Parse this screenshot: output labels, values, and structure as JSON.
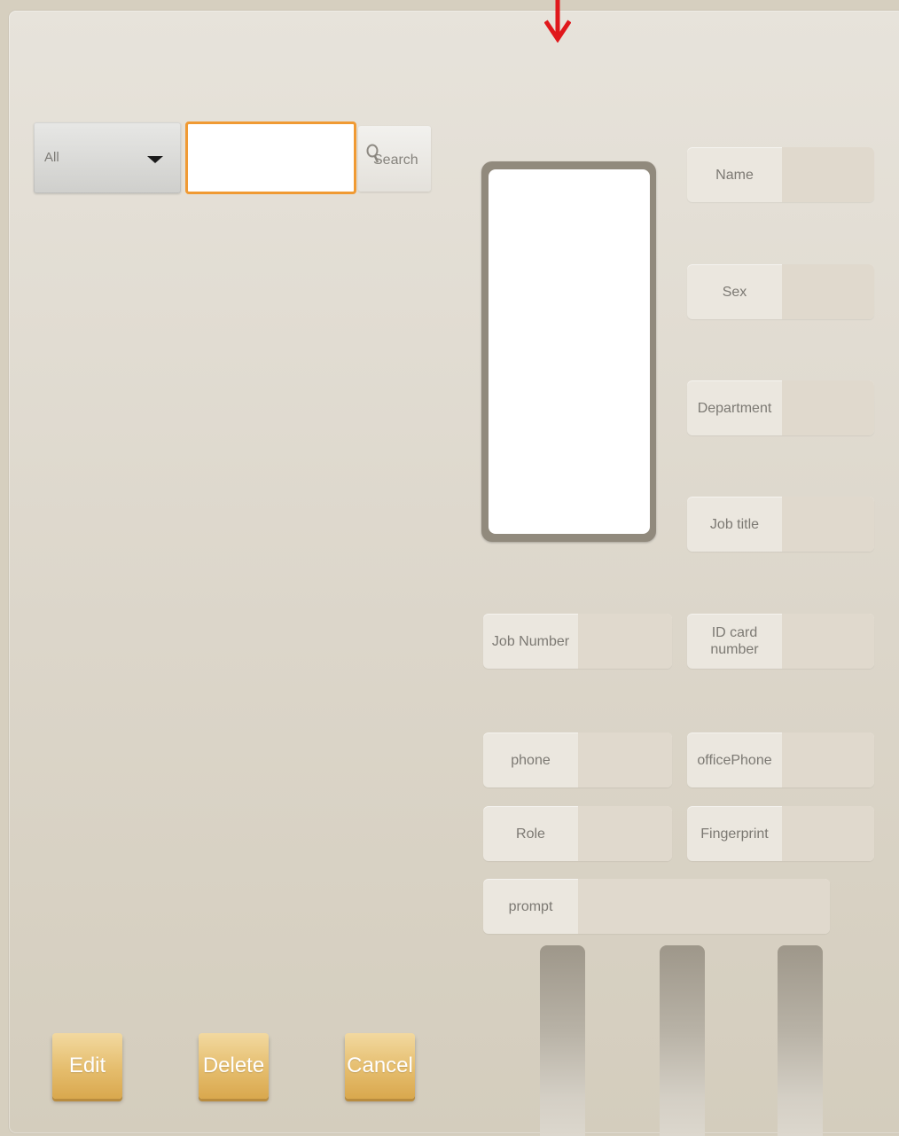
{
  "search": {
    "filter_value": "All",
    "input_value": "",
    "button_label": "Search"
  },
  "fields": {
    "name": "Name",
    "sex": "Sex",
    "department": "Department",
    "job_title": "Job title",
    "job_number": "Job Number",
    "id_card_number": "ID card number",
    "phone": "phone",
    "office_phone": "officePhone",
    "role": "Role",
    "fingerprint": "Fingerprint",
    "prompt": "prompt"
  },
  "actions": {
    "edit": "Edit",
    "delete": "Delete",
    "cancel": "Cancel"
  },
  "colors": {
    "accent": "#f09a33",
    "button_gold": "#e5bd6d",
    "arrow": "#e0181c"
  },
  "icons": {
    "dropdown": "caret-down-icon",
    "search": "search-icon",
    "pointer": "arrow-down-icon"
  }
}
